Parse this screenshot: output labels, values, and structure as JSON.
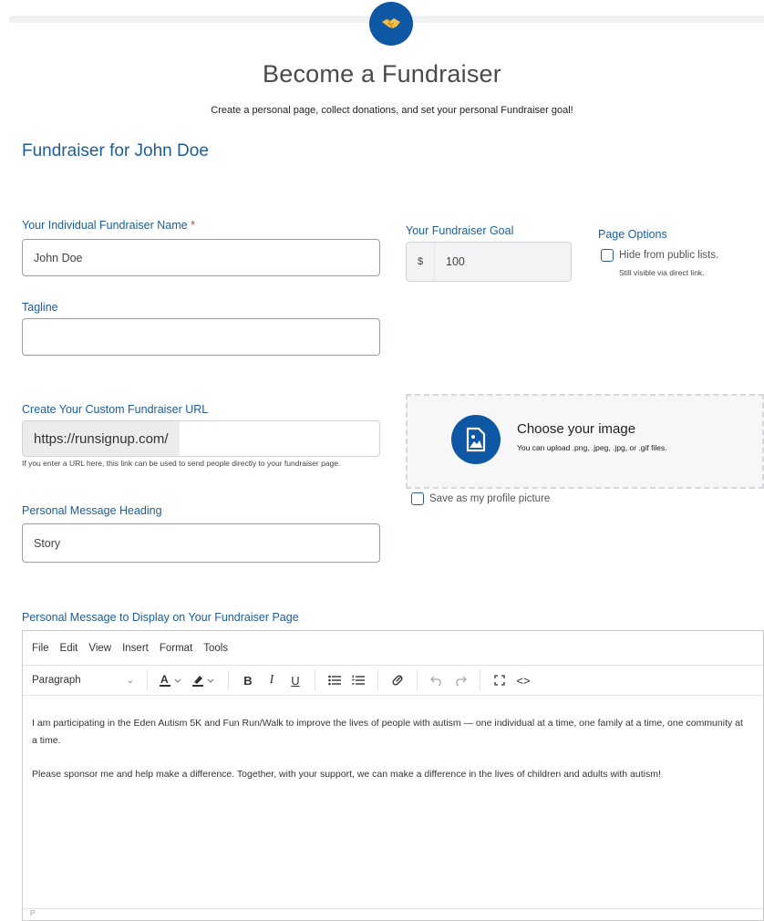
{
  "header": {
    "title": "Become a Fundraiser",
    "subtitle": "Create a personal page, collect donations, and set your personal Fundraiser goal!",
    "logo_icon": "handshake-icon"
  },
  "section": {
    "heading": "Fundraiser for John Doe"
  },
  "form": {
    "name": {
      "label": "Your Individual Fundraiser Name",
      "required_mark": "*",
      "value": "John Doe"
    },
    "goal": {
      "label": "Your Fundraiser Goal",
      "currency": "$",
      "value": "100"
    },
    "page_options": {
      "label": "Page Options",
      "hide_label": "Hide from public lists.",
      "hide_note": "Still visible via direct link."
    },
    "tagline": {
      "label": "Tagline",
      "value": ""
    },
    "custom_url": {
      "label": "Create Your Custom Fundraiser URL",
      "prefix": "https://runsignup.com/",
      "value": "",
      "help": "If you enter a URL here, this link can be used to send people directly to your fundraiser page."
    },
    "image": {
      "title": "Choose your image",
      "help": "You can upload .png, .jpeg, .jpg, or .gif files.",
      "profile_checkbox": "Save as my profile picture"
    },
    "message_heading": {
      "label": "Personal Message Heading",
      "value": "Story"
    },
    "message": {
      "label": "Personal Message to Display on Your Fundraiser Page",
      "menu": [
        "File",
        "Edit",
        "View",
        "Insert",
        "Format",
        "Tools"
      ],
      "block_format": "Paragraph",
      "paragraphs": [
        "I am participating in the Eden Autism 5K and Fun Run/Walk to improve the lives of people with autism — one individual at a time, one family at a time, one community at a time.",
        "Please sponsor me and help make a difference. Together, with your support, we can make a difference in the lives of children and adults with autism!"
      ],
      "status_path": "P"
    }
  },
  "colors": {
    "brand": "#0d57a4",
    "label": "#1c5d99",
    "required": "#d9342b"
  }
}
